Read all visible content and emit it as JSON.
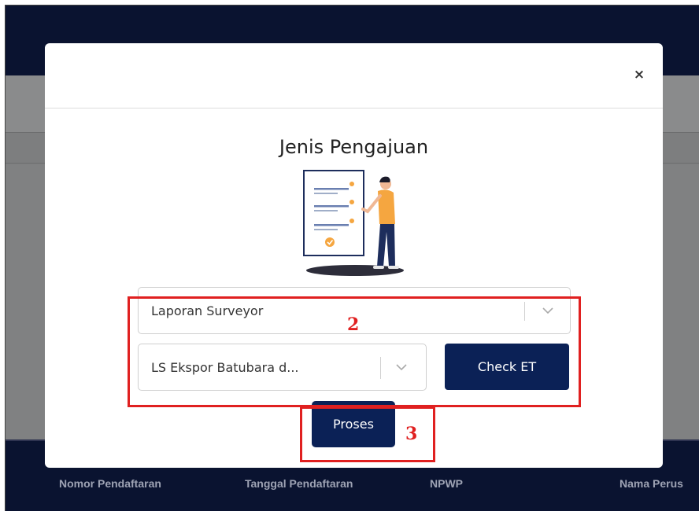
{
  "modal": {
    "title": "Jenis Pengajuan",
    "close_symbol": "×",
    "close_icon": "close-icon",
    "illustration_icon": "document-person-illustration",
    "select_primary": {
      "value": "Laporan Surveyor",
      "icon": "chevron-down-icon"
    },
    "select_secondary": {
      "value": "LS Ekspor Batubara d...",
      "icon": "chevron-down-icon"
    },
    "check_button": "Check ET",
    "proses_button": "Proses"
  },
  "annotations": {
    "step2": "2",
    "step3": "3",
    "color": "#e02020"
  },
  "table": {
    "headers": [
      "Nomor Pendaftaran",
      "Tanggal Pendaftaran",
      "NPWP",
      "Nama Perus"
    ]
  },
  "colors": {
    "primary_button": "#0b2156",
    "header_bg": "#0a1330",
    "overlay": "#808182"
  }
}
